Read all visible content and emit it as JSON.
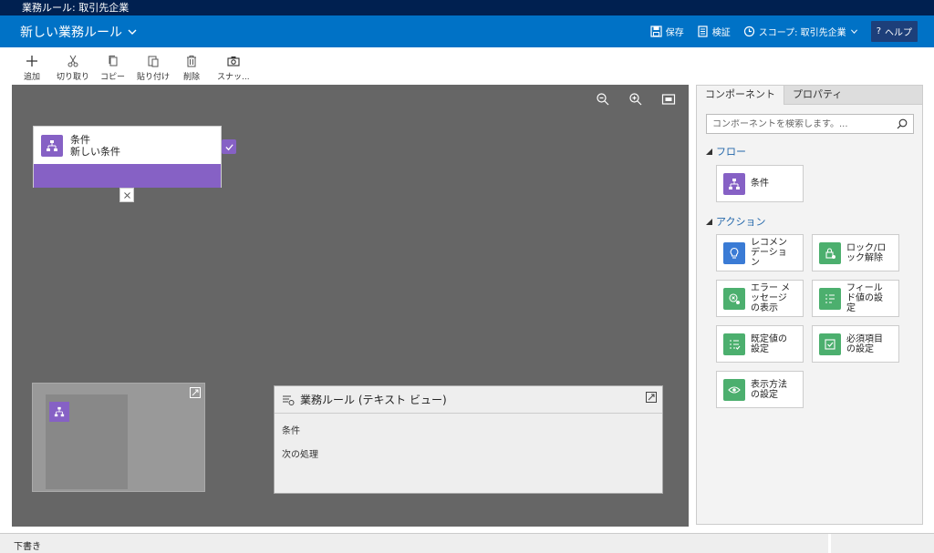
{
  "titlebar": {
    "title": "業務ルール: 取引先企業"
  },
  "header": {
    "rule_name": "新しい業務ルール",
    "save": "保存",
    "validate": "検証",
    "scope": "スコープ: 取引先企業",
    "help": "ヘルプ"
  },
  "toolbar": {
    "add": "追加",
    "cut": "切り取り",
    "copy": "コピー",
    "paste": "貼り付け",
    "delete": "削除",
    "snapshot": "スナッ..."
  },
  "canvas": {
    "condition": {
      "title": "条件",
      "name": "新しい条件"
    },
    "textview": {
      "title": "業務ルール (テキスト ビュー)",
      "line1": "条件",
      "line2": "次の処理"
    }
  },
  "panel": {
    "tabs": [
      "コンポーネント",
      "プロパティ"
    ],
    "search_placeholder": "コンポーネントを検索します。...",
    "flow_label": "フロー",
    "actions_label": "アクション",
    "flow_items": [
      {
        "label": "条件",
        "icon": "condition-icon",
        "color": "#8661c5"
      }
    ],
    "action_items": [
      {
        "label": "レコメン\nデーショ\nン",
        "icon": "lightbulb-icon",
        "color": "#3a7bd5"
      },
      {
        "label": "ロック/ロ\nック解除",
        "icon": "lock-icon",
        "color": "#4caf6e"
      },
      {
        "label": "エラー メ\nッセージ\nの表示",
        "icon": "error-icon",
        "color": "#4caf6e"
      },
      {
        "label": "フィール\nド値の設\n定",
        "icon": "set-field-icon",
        "color": "#4caf6e"
      },
      {
        "label": "既定値の\n設定",
        "icon": "default-value-icon",
        "color": "#4caf6e"
      },
      {
        "label": "必須項目\nの設定",
        "icon": "required-icon",
        "color": "#4caf6e"
      },
      {
        "label": "表示方法\nの設定",
        "icon": "visibility-icon",
        "color": "#4caf6e"
      }
    ]
  },
  "status": {
    "text": "下書き"
  }
}
